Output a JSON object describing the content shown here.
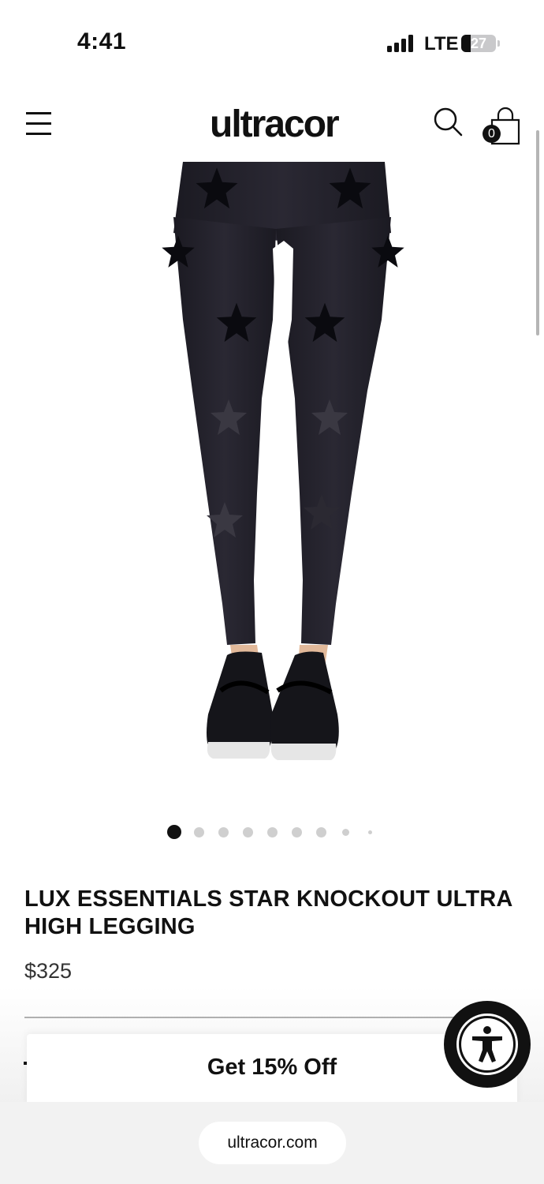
{
  "status_bar": {
    "time": "4:41",
    "network": "LTE",
    "battery": "27",
    "battery_level": 0.27
  },
  "header": {
    "logo": "ultracor",
    "cart_count": "0",
    "icons": [
      "menu-icon",
      "search-icon",
      "shopping-bag-icon"
    ]
  },
  "product": {
    "image_alt_icon": "leggings-image",
    "title": "LUX ESSENTIALS STAR KNOCKOUT ULTRA HIGH LEGGING",
    "price": "$325"
  },
  "carousel": {
    "total_dots": 9,
    "active_index": 0
  },
  "promo": {
    "label": "Get 15% Off"
  },
  "accessibility": {
    "icon": "accessibility-person-icon"
  },
  "browser": {
    "url": "ultracor.com"
  },
  "colors": {
    "text": "#111111",
    "background": "#ffffff",
    "browser_bar": "#f2f2f2",
    "dot_inactive": "#cfcfcf",
    "dot_active": "#111111"
  }
}
